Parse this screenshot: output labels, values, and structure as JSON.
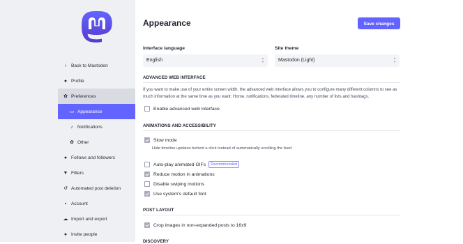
{
  "colors": {
    "accent": "#6364ff",
    "sidebar_bg": "#eff0f4"
  },
  "sidebar": {
    "items": [
      {
        "label": "Back to Mastodon",
        "icon": "chevron-left-icon",
        "glyph": "‹"
      },
      {
        "label": "Profile",
        "icon": "user-icon",
        "glyph": "●"
      },
      {
        "label": "Preferences",
        "icon": "gear-icon",
        "glyph": "✿"
      },
      {
        "label": "Appearance",
        "icon": "monitor-icon",
        "glyph": "▭"
      },
      {
        "label": "Notifications",
        "icon": "bell-icon",
        "glyph": "♪"
      },
      {
        "label": "Other",
        "icon": "gear-icon",
        "glyph": "✿"
      },
      {
        "label": "Follows and followers",
        "icon": "users-icon",
        "glyph": "●"
      },
      {
        "label": "Filters",
        "icon": "filter-icon",
        "glyph": "▼"
      },
      {
        "label": "Automated post deletion",
        "icon": "history-icon",
        "glyph": "↺"
      },
      {
        "label": "Account",
        "icon": "lock-icon",
        "glyph": "▪"
      },
      {
        "label": "Import and export",
        "icon": "cloud-icon",
        "glyph": "☁"
      },
      {
        "label": "Invite people",
        "icon": "user-plus-icon",
        "glyph": "●"
      }
    ]
  },
  "main": {
    "title": "Appearance",
    "save_label": "Save changes",
    "interface_language": {
      "label": "Interface language",
      "value": "English"
    },
    "site_theme": {
      "label": "Site theme",
      "value": "Mastodon (Light)"
    },
    "advanced": {
      "heading": "ADVANCED WEB INTERFACE",
      "hint": "If you want to make use of your entire screen width, the advanced web interface allows you to configure many different columns to see as much information at the same time as you want: Home, notifications, federated timeline, any number of lists and hashtags.",
      "option": "Enable advanced web interface"
    },
    "animations": {
      "heading": "ANIMATIONS AND ACCESSIBILITY",
      "slow_mode": "Slow mode",
      "slow_mode_hint": "Hide timeline updates behind a click instead of automatically scrolling the feed",
      "autoplay": "Auto-play animated GIFs",
      "recommended": "Recommended",
      "reduce_motion": "Reduce motion in animations",
      "disable_swiping": "Disable swiping motions",
      "system_font": "Use system's default font"
    },
    "post_layout": {
      "heading": "POST LAYOUT",
      "crop_images": "Crop images in non-expanded posts to 16x9"
    },
    "discovery": {
      "heading": "DISCOVERY"
    }
  }
}
